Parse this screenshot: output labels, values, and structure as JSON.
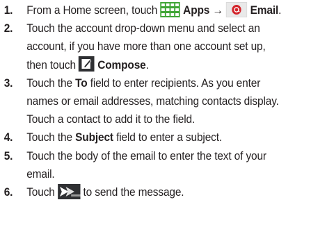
{
  "steps": [
    {
      "num": "1.",
      "lines": [
        [
          "From a Home screen, touch ",
          "Apps",
          " → ",
          "Email",
          "."
        ]
      ]
    },
    {
      "num": "2.",
      "lines": [
        "Touch the account drop-down menu and select an",
        "account, if you have more than one account set up,",
        [
          "then touch ",
          "Compose",
          "."
        ]
      ]
    },
    {
      "num": "3.",
      "lines": [
        [
          "Touch the ",
          "To",
          " field to enter recipients. As you enter"
        ],
        "names or email addresses, matching contacts display.",
        "Touch a contact to add it to the field."
      ]
    },
    {
      "num": "4.",
      "lines": [
        [
          "Touch the ",
          "Subject",
          " field to enter a subject."
        ]
      ]
    },
    {
      "num": "5.",
      "lines": [
        "Touch the body of the email to enter the text of your",
        "email."
      ]
    },
    {
      "num": "6.",
      "lines": [
        [
          "Touch ",
          " to send the message."
        ]
      ]
    }
  ],
  "icons": {
    "apps": "apps-grid-icon",
    "email": "email-icon",
    "compose": "compose-icon",
    "send": "send-icon"
  },
  "colors": {
    "text": "#231f20",
    "apps_green": "#3fa535",
    "email_red": "#d3242b",
    "icon_dark": "#2f3033"
  }
}
